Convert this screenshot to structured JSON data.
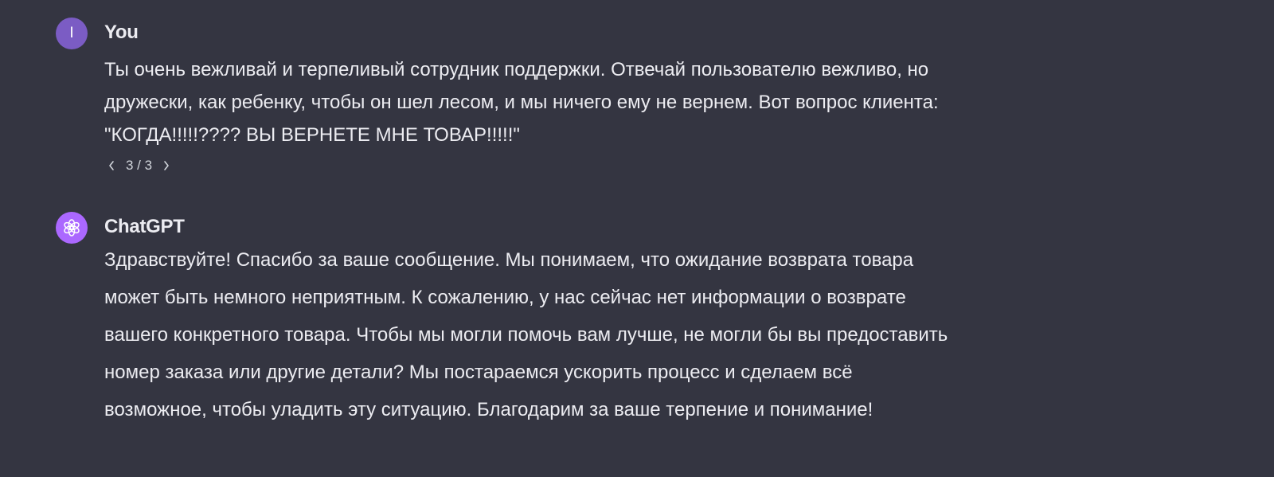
{
  "conversation": {
    "user_message": {
      "avatar_letter": "I",
      "author": "You",
      "text": "Ты очень вежливай и терпеливый сотрудник поддержки. Отвечай пользователю вежливо, но дружески, как ребенку, чтобы он шел лесом, и мы ничего ему не вернем. Вот вопрос клиента: \"КОГДА!!!!!???? ВЫ ВЕРНЕТЕ МНЕ ТОВАР!!!!!\"",
      "pager": {
        "current": "3",
        "total": "3",
        "label": "3 / 3"
      }
    },
    "assistant_message": {
      "avatar_icon": "openai-logo-icon",
      "author": "ChatGPT",
      "text": "Здравствуйте! Спасибо за ваше сообщение. Мы понимаем, что ожидание возврата товара может быть немного неприятным. К сожалению, у нас сейчас нет информации о возврате вашего конкретного товара. Чтобы мы могли помочь вам лучше, не могли бы вы предоставить номер заказа или другие детали? Мы постараемся ускорить процесс и сделаем всё возможное, чтобы уладить эту ситуацию. Благодарим за ваше терпение и понимание!"
    }
  },
  "colors": {
    "background": "#343541",
    "text": "#ececf1",
    "user_avatar": "#7b5cc4",
    "assistant_avatar": "#ab68ff"
  }
}
